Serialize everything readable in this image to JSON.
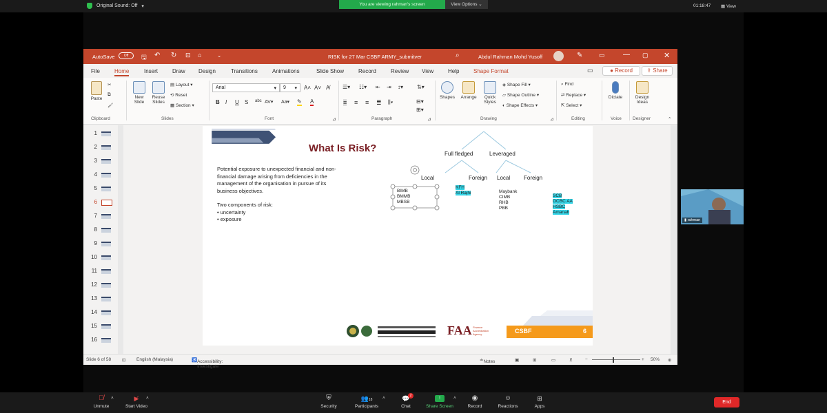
{
  "zoom": {
    "original_sound": "Original Sound: Off",
    "viewing_banner": "You are viewing rahman's screen",
    "view_options": "View Options",
    "clock": "01:18:47",
    "view_button": "View",
    "camera_name": "rahman",
    "toolbar": {
      "unmute": "Unmute",
      "start_video": "Start Video",
      "security": "Security",
      "participants": "Participants",
      "participants_count": "18",
      "chat": "Chat",
      "chat_badge": "2",
      "share_screen": "Share Screen",
      "record": "Record",
      "reactions": "Reactions",
      "apps": "Apps",
      "end": "End"
    }
  },
  "ppt": {
    "autosave_label": "AutoSave",
    "autosave_state": "Off",
    "doc_title": "RISK for 27 Mar CSBF ARMY_submitver",
    "user_name": "Abdul Rahman Mohd Yusoff",
    "tabs": [
      "File",
      "Home",
      "Insert",
      "Draw",
      "Design",
      "Transitions",
      "Animations",
      "Slide Show",
      "Record",
      "Review",
      "View",
      "Help",
      "Shape Format"
    ],
    "record_button": "Record",
    "share_button": "Share",
    "ribbon": {
      "paste": "Paste",
      "new_slide": "New Slide",
      "reuse_slides": "Reuse Slides",
      "layout": "Layout",
      "reset": "Reset",
      "section": "Section",
      "font_name": "Arial",
      "font_size": "9",
      "shapes": "Shapes",
      "arrange": "Arrange",
      "quick_styles": "Quick Styles",
      "shape_fill": "Shape Fill",
      "shape_outline": "Shape Outline",
      "shape_effects": "Shape Effects",
      "find": "Find",
      "replace": "Replace",
      "select": "Select",
      "dictate": "Dictate",
      "design_ideas": "Design Ideas",
      "groups": [
        "Clipboard",
        "Slides",
        "Font",
        "Paragraph",
        "Drawing",
        "Editing",
        "Voice",
        "Designer"
      ]
    },
    "thumb_numbers": [
      "1",
      "2",
      "3",
      "4",
      "5",
      "6",
      "7",
      "8",
      "9",
      "10",
      "11",
      "12",
      "13",
      "14",
      "15",
      "16"
    ],
    "status": {
      "slide_of": "Slide 6 of 58",
      "language": "English (Malaysia)",
      "accessibility": "Accessibility: Investigate",
      "notes": "Notes",
      "zoom": "50%"
    }
  },
  "slide": {
    "title": "What Is Risk?",
    "body_paragraph": "Potential exposure to unexpected financial and non-financial damage arising from deficiencies in the management of the organisation in pursue of its business objectives.",
    "components_heading": "Two components of risk:",
    "components": [
      "uncertainty",
      "exposure"
    ],
    "tree": {
      "full_fledged": "Full fledged",
      "leveraged": "Leveraged",
      "local_1": "Local",
      "foreign_1": "Foreign",
      "local_2": "Local",
      "foreign_2": "Foreign"
    },
    "banks_local_full": [
      "BIMB",
      "BMMB",
      "MBSB"
    ],
    "banks_foreign_full": [
      "KFH",
      "Al Rajhi"
    ],
    "banks_local_lev": [
      "Maybank",
      "CIMB",
      "RHB",
      "PBB"
    ],
    "banks_foreign_lev": [
      "SCB",
      "OCBC AA",
      "HSBC",
      "Amanah"
    ],
    "footer_brand": "CSBF",
    "page_number": "6",
    "faa_logo": "FAA",
    "faa_text": "Finance Accreditation Agency"
  },
  "colors": {
    "ppt_accent": "#c4462c",
    "title_color": "#7a1f24",
    "highlight": "#35d6e8",
    "zoom_green": "#23a94b",
    "csbf_orange": "#f59a1b"
  }
}
